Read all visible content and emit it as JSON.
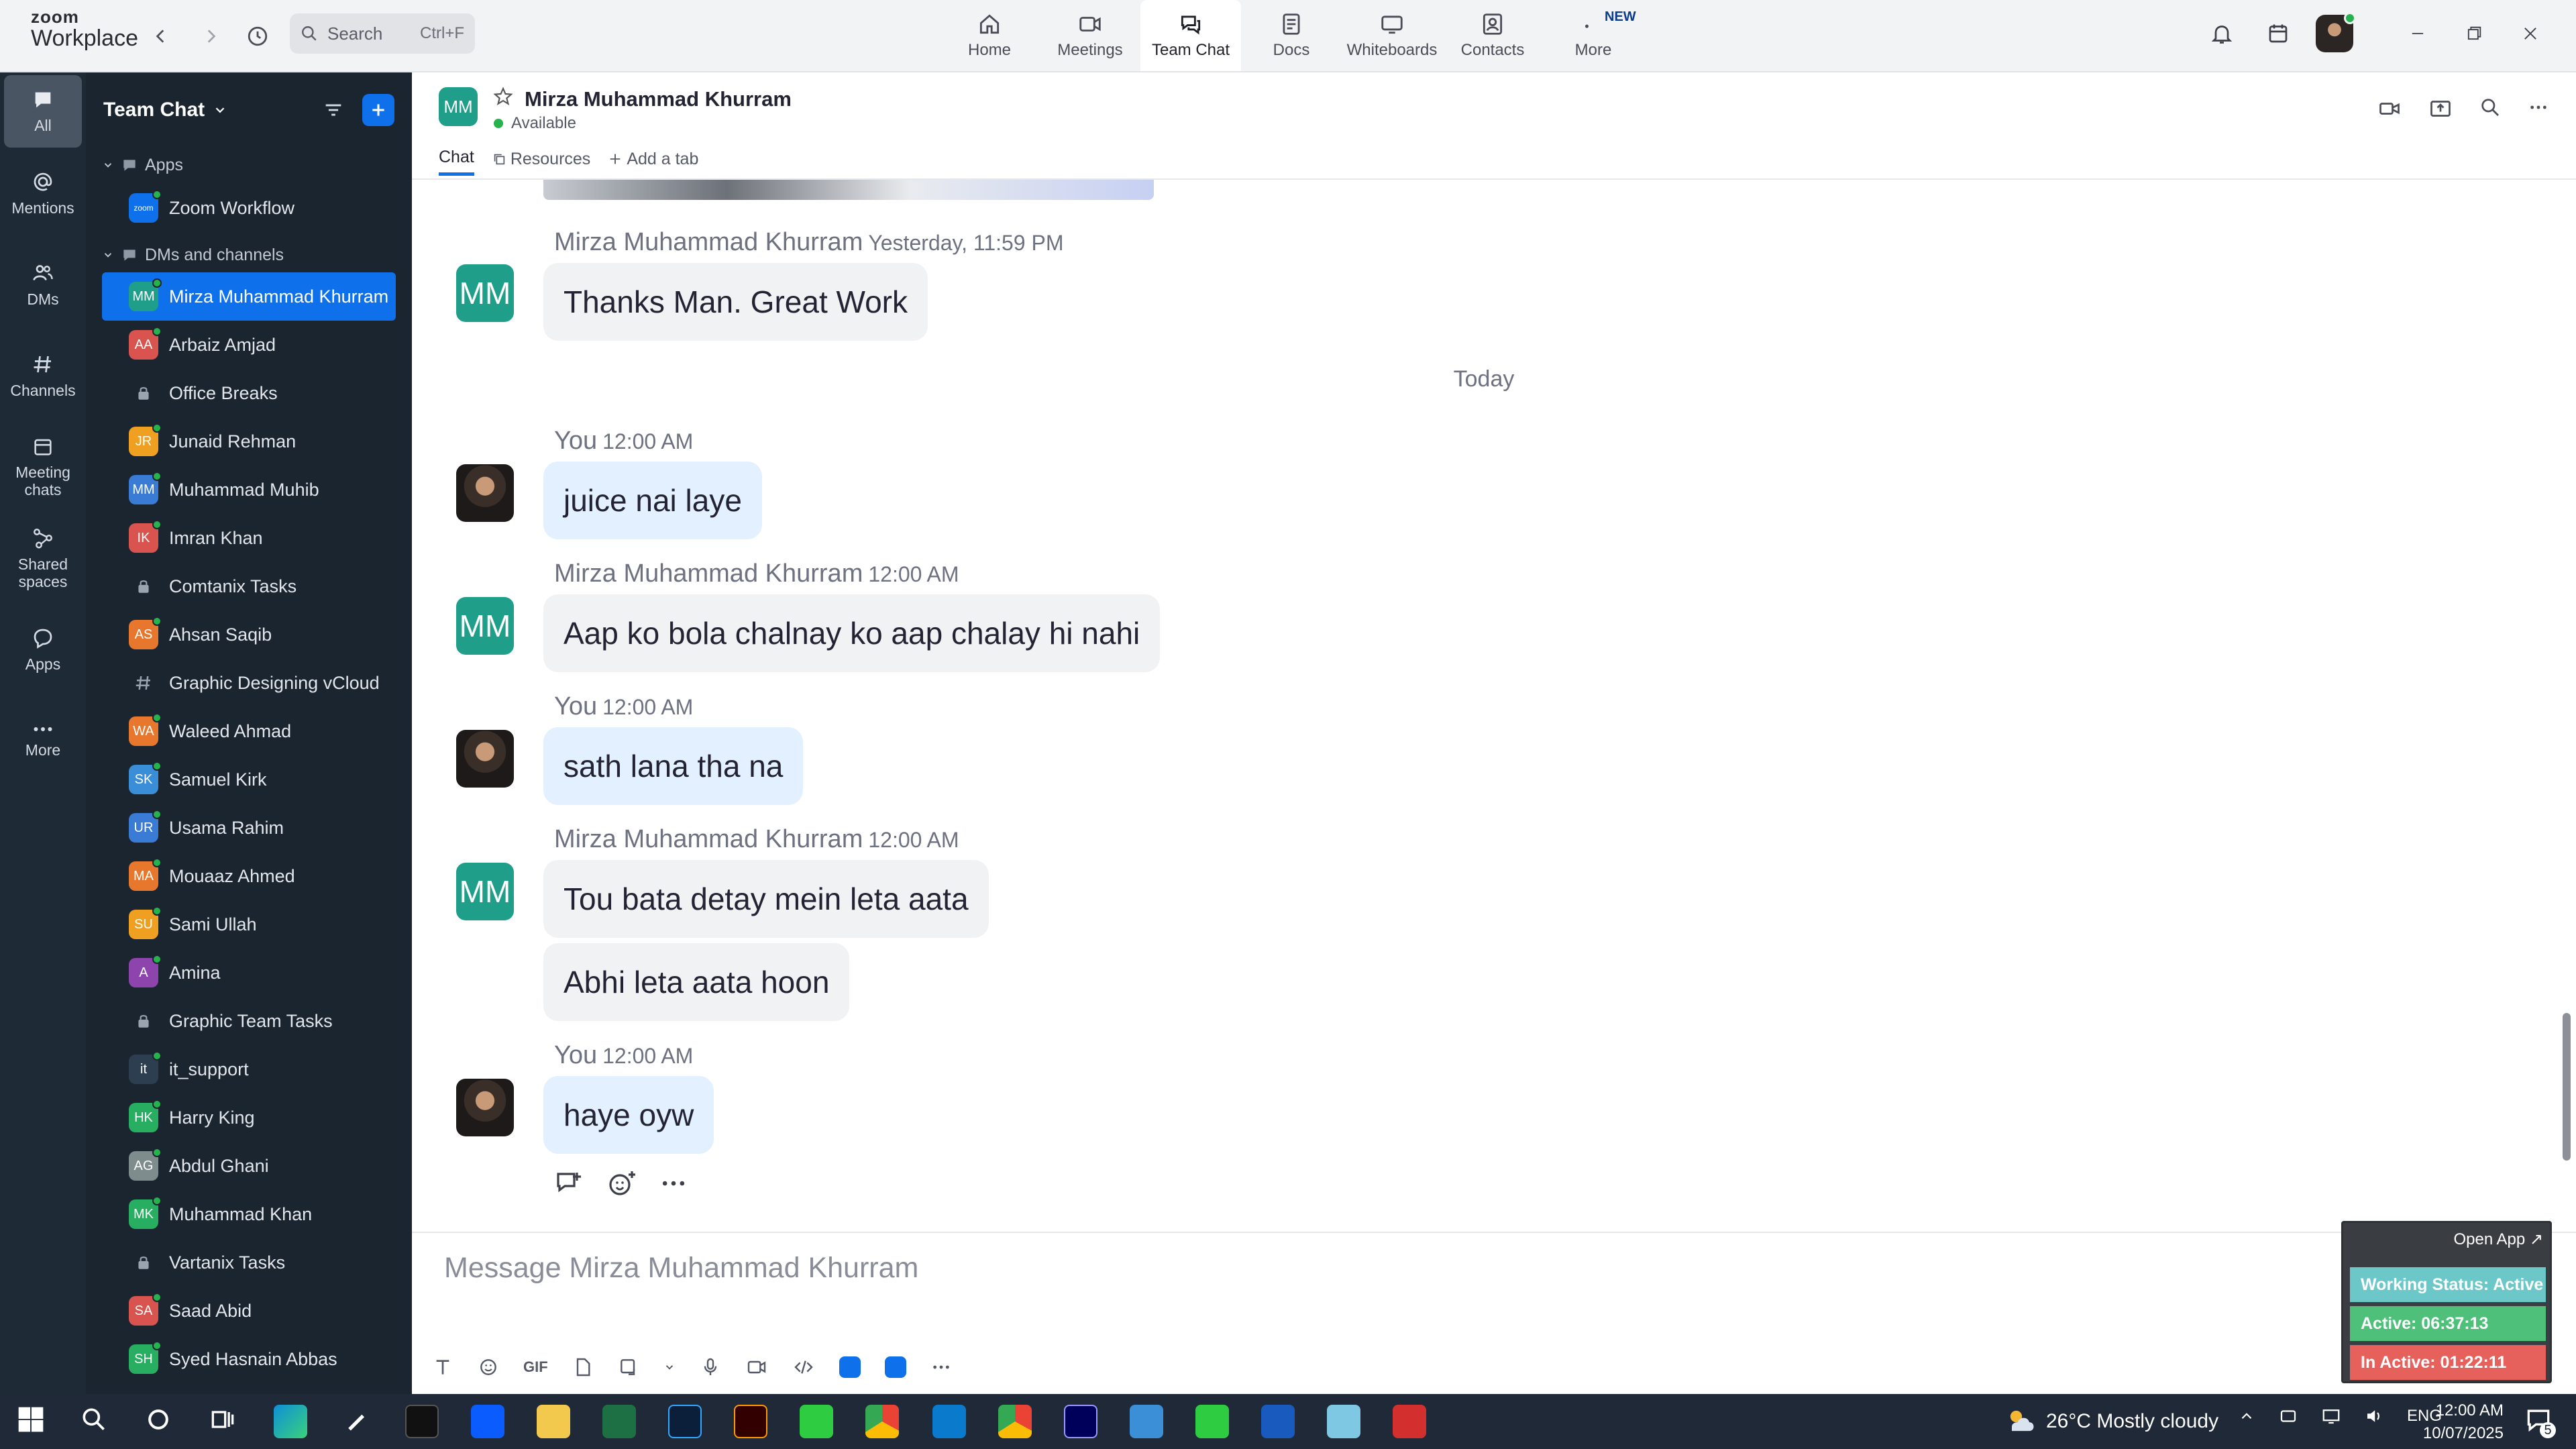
{
  "app": {
    "logo_line1": "zoom",
    "logo_line2": "Workplace",
    "search_placeholder": "Search",
    "search_shortcut": "Ctrl+F"
  },
  "nav": {
    "tabs": [
      {
        "label": "Home",
        "icon": "home-icon"
      },
      {
        "label": "Meetings",
        "icon": "video-icon"
      },
      {
        "label": "Team Chat",
        "icon": "chat-icon"
      },
      {
        "label": "Docs",
        "icon": "docs-icon"
      },
      {
        "label": "Whiteboards",
        "icon": "whiteboard-icon"
      },
      {
        "label": "Contacts",
        "icon": "contacts-icon"
      },
      {
        "label": "More",
        "icon": "more-icon",
        "badge": "NEW"
      }
    ],
    "active": "Team Chat"
  },
  "rail": {
    "items": [
      {
        "label": "All"
      },
      {
        "label": "Mentions"
      },
      {
        "label": "DMs"
      },
      {
        "label": "Channels"
      },
      {
        "label": "Meeting chats"
      },
      {
        "label": "Shared spaces"
      },
      {
        "label": "Apps"
      },
      {
        "label": "More"
      }
    ]
  },
  "sidebar": {
    "title": "Team Chat",
    "apps_section": "Apps",
    "apps": [
      {
        "label": "Zoom Workflow"
      }
    ],
    "dms_section": "DMs and channels",
    "items": [
      {
        "label": "Mirza Muhammad Khurram",
        "initials": "MM",
        "color": "#1f9e8a"
      },
      {
        "label": "Arbaiz Amjad",
        "initials": "AA",
        "color": "#d9534f"
      },
      {
        "label": "Office Breaks",
        "type": "lock"
      },
      {
        "label": "Junaid Rehman",
        "initials": "JR",
        "color": "#f0a020"
      },
      {
        "label": "Muhammad Muhib",
        "initials": "MM",
        "color": "#3a7bd5"
      },
      {
        "label": "Imran Khan",
        "initials": "IK",
        "color": "#d9534f"
      },
      {
        "label": "Comtanix Tasks",
        "type": "lock"
      },
      {
        "label": "Ahsan Saqib",
        "initials": "AS",
        "color": "#e8772e"
      },
      {
        "label": "Graphic Designing vCloud",
        "type": "hash"
      },
      {
        "label": "Waleed Ahmad",
        "initials": "WA",
        "color": "#e8772e"
      },
      {
        "label": "Samuel Kirk",
        "initials": "SK",
        "color": "#3a8ed8"
      },
      {
        "label": "Usama Rahim",
        "initials": "UR",
        "color": "#3a7bd5"
      },
      {
        "label": "Mouaaz Ahmed",
        "initials": "MA",
        "color": "#e8772e"
      },
      {
        "label": "Sami Ullah",
        "initials": "SU",
        "color": "#f0a020"
      },
      {
        "label": "Amina",
        "initials": "A",
        "color": "#8e44ad"
      },
      {
        "label": "Graphic Team Tasks",
        "type": "lock"
      },
      {
        "label": "it_support",
        "initials": "it",
        "color": "#2c3e50"
      },
      {
        "label": "Harry King",
        "initials": "HK",
        "color": "#27ae60"
      },
      {
        "label": "Abdul Ghani",
        "initials": "AG",
        "color": "#7f8c8d"
      },
      {
        "label": "Muhammad Khan",
        "initials": "MK",
        "color": "#27ae60"
      },
      {
        "label": "Vartanix Tasks",
        "type": "lock"
      },
      {
        "label": "Saad Abid",
        "initials": "SA",
        "color": "#d9534f"
      },
      {
        "label": "Syed Hasnain Abbas",
        "initials": "SH",
        "color": "#27ae60"
      }
    ]
  },
  "chat": {
    "contact_initials": "MM",
    "contact_name": "Mirza Muhammad Khurram",
    "status": "Available",
    "tabs": {
      "chat": "Chat",
      "resources": "Resources",
      "add": "Add a tab"
    },
    "day_separator": "Today",
    "messages": [
      {
        "sender": "Mirza Muhammad Khurram",
        "time": "Yesterday, 11:59 PM",
        "text": "Thanks Man. Great Work"
      },
      {
        "sender": "You",
        "time": "12:00 AM",
        "text": "juice nai laye"
      },
      {
        "sender": "Mirza Muhammad Khurram",
        "time": "12:00 AM",
        "text": "Aap ko bola chalnay ko aap chalay hi nahi"
      },
      {
        "sender": "You",
        "time": "12:00 AM",
        "text": "sath lana tha na"
      },
      {
        "sender": "Mirza Muhammad Khurram",
        "time": "12:00 AM",
        "text": "Tou bata detay mein leta aata",
        "extra": "Abhi leta aata hoon"
      },
      {
        "sender": "You",
        "time": "12:00 AM",
        "text": "haye oyw"
      }
    ],
    "compose_placeholder": "Message Mirza Muhammad Khurram",
    "gif_label": "GIF"
  },
  "widget": {
    "open_app": "Open App ↗",
    "working_status": "Working Status: Active",
    "active": "Active: 06:37:13",
    "inactive": "In Active: 01:22:11",
    "colors": {
      "working": "#6cc7c9",
      "active": "#4fc07a",
      "inactive": "#e6615c"
    }
  },
  "taskbar": {
    "weather": "26°C  Mostly cloudy",
    "lang": "ENG",
    "time": "12:00 AM",
    "date": "10/07/2025",
    "notif_count": "5"
  }
}
